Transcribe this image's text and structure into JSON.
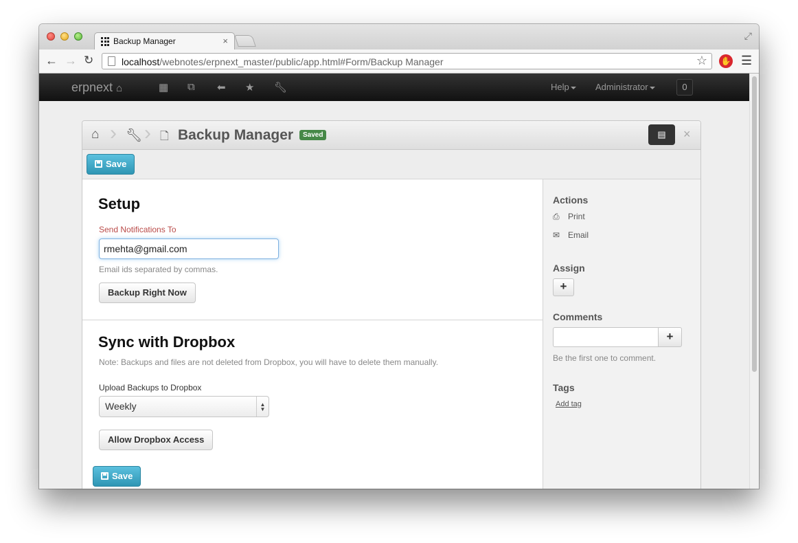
{
  "browser": {
    "tab_title": "Backup Manager",
    "tab_close": "×",
    "url_host": "localhost",
    "url_path": "/webnotes/erpnext_master/public/app.html#Form/Backup Manager"
  },
  "navbar": {
    "brand": "erpnext",
    "help_label": "Help",
    "user_label": "Administrator",
    "notification_count": "0"
  },
  "form": {
    "title": "Backup Manager",
    "status_badge": "Saved",
    "save_label": "Save",
    "close_label": "×"
  },
  "setup": {
    "heading": "Setup",
    "notify_label": "Send Notifications To",
    "notify_value": "rmehta@gmail.com",
    "notify_help": "Email ids separated by commas.",
    "backup_button": "Backup Right Now"
  },
  "dropbox": {
    "heading": "Sync with Dropbox",
    "note": "Note: Backups and files are not deleted from Dropbox, you will have to delete them manually.",
    "upload_label": "Upload Backups to Dropbox",
    "upload_value": "Weekly",
    "allow_button": "Allow Dropbox Access"
  },
  "sidebar": {
    "actions_heading": "Actions",
    "print_label": "Print",
    "email_label": "Email",
    "assign_heading": "Assign",
    "comments_heading": "Comments",
    "comments_help": "Be the first one to comment.",
    "tags_heading": "Tags",
    "add_tag_label": "Add tag",
    "plus_symbol": "+"
  },
  "colors": {
    "primary_button": "#49afcd",
    "saved_badge": "#468847",
    "required_label": "#b94a48",
    "navbar": "#222222"
  }
}
